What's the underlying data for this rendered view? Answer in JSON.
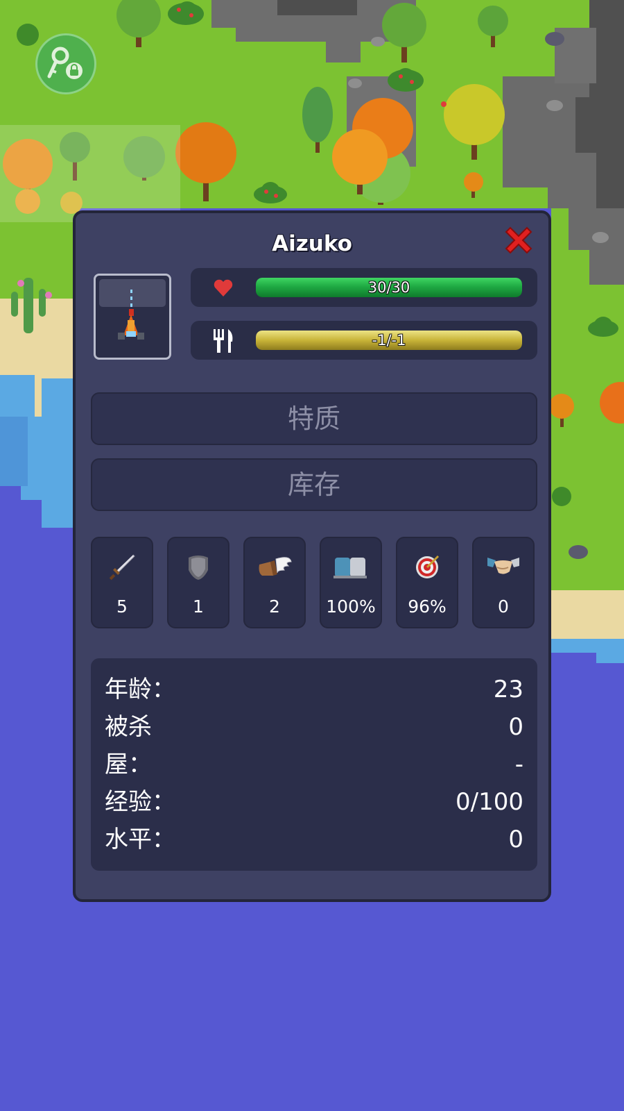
{
  "colors": {
    "panel": "#3e4163",
    "panel_dark": "#2b2e4a",
    "health_bar": "#1faa43",
    "food_bar": "#c8b438",
    "close": "#e02020",
    "water": "#5658d2",
    "grass": "#7cc232"
  },
  "lock_button": {
    "icon": "key-lock-icon"
  },
  "unit": {
    "name": "Aizuko",
    "portrait_icon": "unit-portrait-icon"
  },
  "bars": {
    "health": {
      "icon": "heart-icon",
      "text": "30/30",
      "fill": 1.0
    },
    "hunger": {
      "icon": "fork-knife-icon",
      "text": "-1/-1",
      "fill": 1.0
    }
  },
  "sections": {
    "traits": "特质",
    "inventory": "库存"
  },
  "stats": [
    {
      "icon": "sword-icon",
      "value": "5"
    },
    {
      "icon": "armor-icon",
      "value": "1"
    },
    {
      "icon": "wing-boot-icon",
      "value": "2"
    },
    {
      "icon": "stamina-icon",
      "value": "100%"
    },
    {
      "icon": "target-icon",
      "value": "96%"
    },
    {
      "icon": "handshake-icon",
      "value": "0"
    }
  ],
  "info": [
    {
      "label": "年龄：",
      "value": "23"
    },
    {
      "label": "被杀",
      "value": "0"
    },
    {
      "label": "屋：",
      "value": "-"
    },
    {
      "label": "经验：",
      "value": "0/100"
    },
    {
      "label": "水平：",
      "value": "0"
    }
  ]
}
